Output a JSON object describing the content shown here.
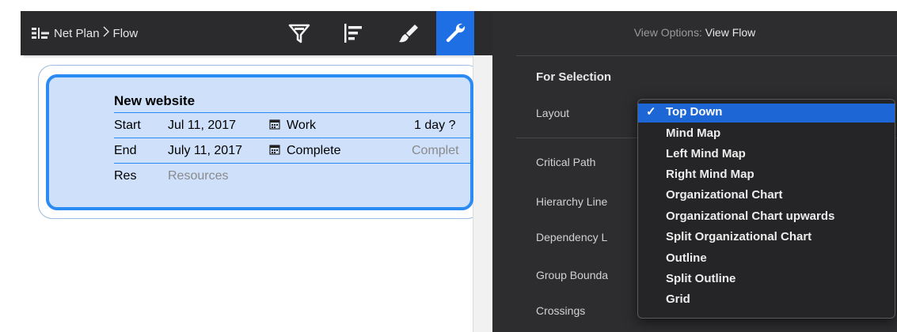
{
  "breadcrumb": {
    "root": "Net Plan",
    "separator": ">",
    "current": "Flow"
  },
  "toolbar": {
    "icons": [
      "filter-icon",
      "gantt-icon",
      "brush-icon",
      "wrench-icon"
    ],
    "active": "wrench-icon",
    "active_color": "#1d6fe3"
  },
  "task_card": {
    "title": "New website",
    "rows": [
      {
        "label": "Start",
        "date": "Jul 11, 2017",
        "icon": "calendar-icon",
        "field": "Work",
        "value": "1 day ?"
      },
      {
        "label": "End",
        "date": "July 11, 2017",
        "icon": "calendar-icon",
        "field": "Complete",
        "value": "Complet"
      },
      {
        "label": "Res",
        "placeholder": "Resources"
      }
    ],
    "border_color": "#2a8bf2",
    "fill_color": "#cfe0fa"
  },
  "panel": {
    "title_prefix": "View Options:",
    "title_value": "View Flow",
    "section": "For Selection",
    "labels": [
      "Layout",
      "Critical Path",
      "Hierarchy Line",
      "Dependency L",
      "Group Bounda",
      "Crossings"
    ]
  },
  "layout_menu": {
    "selected": "Top Down",
    "checkmark": "✓",
    "options": [
      "Top Down",
      "Mind Map",
      "Left Mind Map",
      "Right Mind Map",
      "Organizational Chart",
      "Organizational Chart upwards",
      "Split Organizational Chart",
      "Outline",
      "Split Outline",
      "Grid"
    ],
    "highlight_color": "#1d66d6"
  }
}
